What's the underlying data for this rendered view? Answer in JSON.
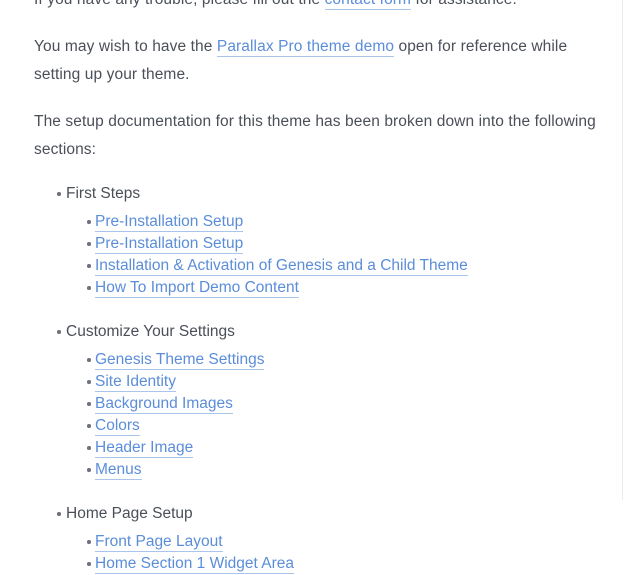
{
  "document": {
    "paragraphs": [
      {
        "id": "trouble",
        "before": "If you have any trouble, please fill out the ",
        "link": "contact form",
        "after": " for assistance."
      },
      {
        "id": "demo-reference",
        "before": "You may wish to have the ",
        "link": "Parallax Pro theme demo",
        "after": " open for reference while setting up your theme."
      }
    ],
    "intro_line": "The setup documentation for this theme has been broken down into the following sections:",
    "sections": [
      {
        "title": "First Steps",
        "links": [
          "Pre-Installation Setup",
          "Pre-Installation Setup",
          "Installation & Activation of Genesis and a Child Theme",
          "How To Import Demo Content"
        ]
      },
      {
        "title": "Customize Your Settings",
        "links": [
          "Genesis Theme Settings",
          "Site Identity",
          "Background Images",
          "Colors",
          "Header Image",
          "Menus"
        ]
      },
      {
        "title": "Home Page Setup",
        "links": [
          "Front Page Layout",
          "Home Section 1 Widget Area"
        ]
      }
    ]
  },
  "theme": {
    "link_color": "#5b8dd9",
    "link_underline_color": "#a9c5ea",
    "text_color": "#4a4f58",
    "background_color": "#ffffff",
    "divider_color": "#e7edf3"
  }
}
